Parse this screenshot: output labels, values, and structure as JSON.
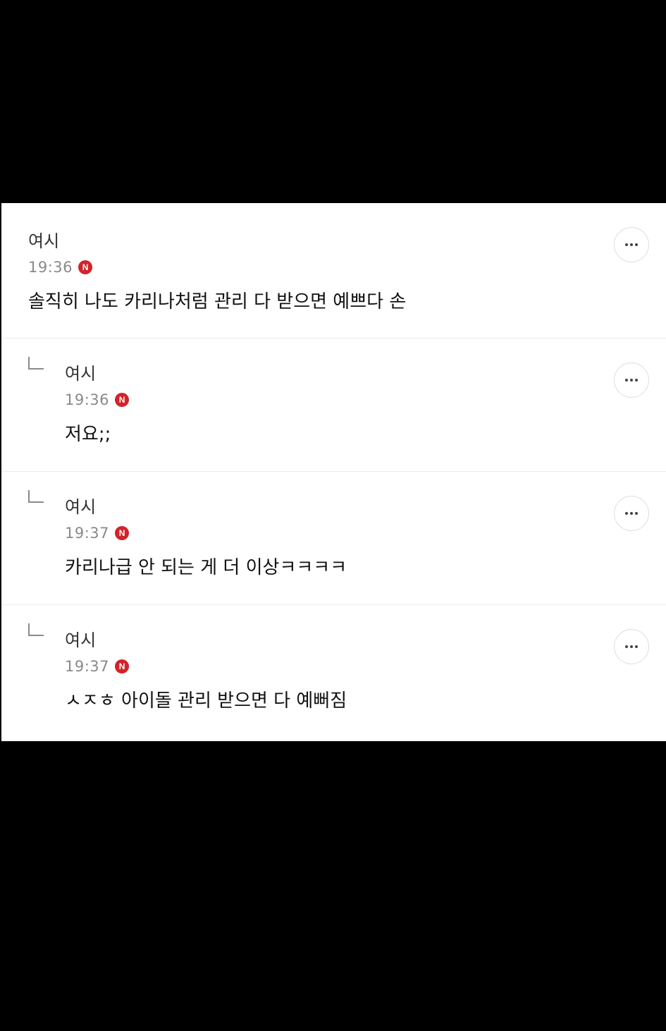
{
  "comments": [
    {
      "author": "여시",
      "time": "19:36",
      "badge": "N",
      "text": "솔직히 나도 카리나처럼 관리 다 받으면 예쁘다 손",
      "is_reply": false
    },
    {
      "author": "여시",
      "time": "19:36",
      "badge": "N",
      "text": "저요;;",
      "is_reply": true
    },
    {
      "author": "여시",
      "time": "19:37",
      "badge": "N",
      "text": "카리나급 안 되는 게 더 이상ㅋㅋㅋㅋ",
      "is_reply": true
    },
    {
      "author": "여시",
      "time": "19:37",
      "badge": "N",
      "text": "ㅅㅈㅎ 아이돌 관리 받으면 다 예뻐짐",
      "is_reply": true
    }
  ],
  "icons": {
    "more": "more-options-icon",
    "new": "new-badge-icon",
    "reply": "reply-arrow-icon"
  },
  "colors": {
    "badge": "#d2232a",
    "background": "#000000",
    "panel": "#ffffff"
  }
}
